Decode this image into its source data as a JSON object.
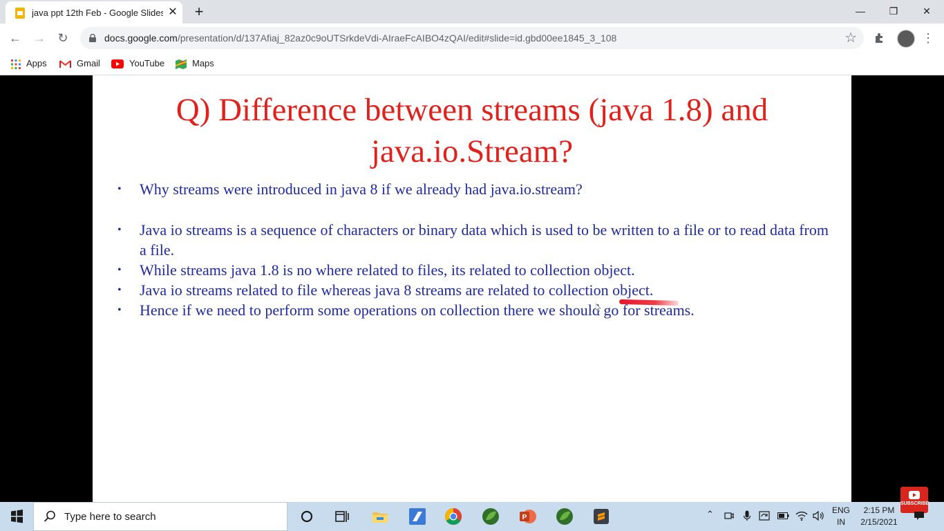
{
  "browser": {
    "tab": {
      "title": "java ppt 12th Feb - Google Slides",
      "close": "✕"
    },
    "new_tab": "+",
    "window_controls": {
      "minimize": "—",
      "maximize": "❐",
      "close": "✕"
    },
    "nav": {
      "back": "←",
      "forward": "→",
      "reload": "↻"
    },
    "url": {
      "host": "docs.google.com",
      "path": "/presentation/d/137Afiaj_82az0c9oUTSrkdeVdi-AIraeFcAIBO4zQAI/edit#slide=id.gbd00ee1845_3_108"
    },
    "bookmarks": [
      {
        "label": "Apps",
        "icon": "apps-grid-icon"
      },
      {
        "label": "Gmail",
        "icon": "gmail-icon"
      },
      {
        "label": "YouTube",
        "icon": "youtube-icon"
      },
      {
        "label": "Maps",
        "icon": "maps-icon"
      }
    ]
  },
  "slide": {
    "title_line1": "Q) Difference between streams (java 1.8) and",
    "title_line2": "java.io.Stream?",
    "title_color": "#e0211c",
    "text_color": "#1f2a9e",
    "bullets": [
      "Why streams were introduced in java 8 if we already had java.io.stream?",
      "Java io streams is a sequence of characters or binary data which is used to be written to a file or to read data from a file.",
      "While streams java 1.8 is no where related to files, its related to collection object.",
      "Java io streams related to file whereas java 8 streams are related to collection object.",
      "Hence if we need to perform some operations on collection there we should go for streams."
    ],
    "bullet_glyph": "•"
  },
  "taskbar": {
    "search_placeholder": "Type here to search",
    "apps": [
      "cortana-icon",
      "task-view-icon",
      "file-explorer-icon",
      "editor-app-icon",
      "chrome-icon",
      "spring-tool-icon",
      "powerpoint-icon",
      "spring-tool-icon-2",
      "sublime-icon"
    ],
    "language": {
      "line1": "ENG",
      "line2": "IN"
    },
    "time": "2:15 PM",
    "date": "2/15/2021",
    "subscribe": "SUBSCRIBE"
  }
}
